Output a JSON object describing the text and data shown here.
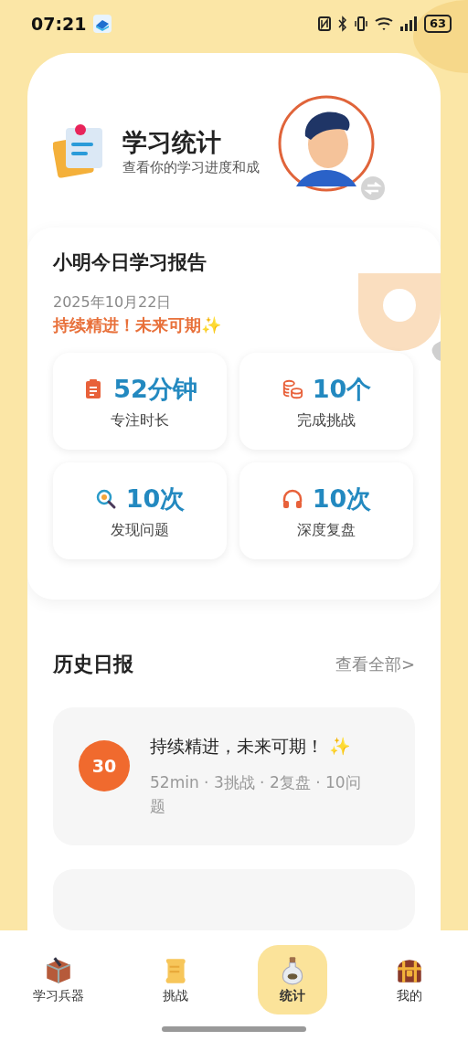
{
  "status_bar": {
    "time": "07:21",
    "battery": "63"
  },
  "header": {
    "title": "学习统计",
    "subtitle": "查看你的学习进度和成"
  },
  "report": {
    "title": "小明今日学习报告",
    "date": "2025年10月22日",
    "motto": "持续精进！未来可期✨",
    "stats": [
      {
        "kind": "clipboard",
        "value": "52分钟",
        "label": "专注时长"
      },
      {
        "kind": "coins",
        "value": "10个",
        "label": "完成挑战"
      },
      {
        "kind": "magnifier",
        "value": "10次",
        "label": "发现问题"
      },
      {
        "kind": "headphones",
        "value": "10次",
        "label": "深度复盘"
      }
    ]
  },
  "history": {
    "title": "历史日报",
    "view_all": "查看全部>",
    "entries": [
      {
        "day": "30",
        "title": "持续精进，未来可期！ ✨",
        "meta": "52min · 3挑战 · 2复盘 · 10问题"
      }
    ]
  },
  "tab_bar": [
    {
      "kind": "toolbox",
      "label": "学习兵器",
      "selected": false
    },
    {
      "kind": "scroll",
      "label": "挑战",
      "selected": false
    },
    {
      "kind": "bottle",
      "label": "统计",
      "selected": true
    },
    {
      "kind": "chest",
      "label": "我的",
      "selected": false
    }
  ]
}
